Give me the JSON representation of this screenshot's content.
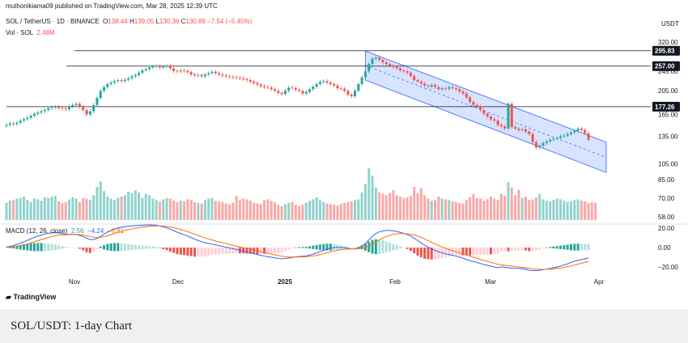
{
  "header": {
    "published": "muthonikiama09 published on TradingView.com, Mar 28, 2025 12:39 UTC",
    "symbol": "SOL / TetherUS · 1D · BINANCE",
    "o_label": "O",
    "o": "138.44",
    "h_label": "H",
    "h": "139.05",
    "l_label": "L",
    "l": "130.36",
    "c_label": "C",
    "c": "130.89",
    "change": "−7.54 (−5.45%)",
    "vol_label": "Vol · SOL",
    "vol": "2.48M",
    "currency": "USDT"
  },
  "macd": {
    "label": "MACD (12, 26, close)",
    "hist": "2.56",
    "macd": "−4.24",
    "signal": "−6.81"
  },
  "footer": {
    "logo": "TradingView",
    "caption": "SOL/USDT: 1-day Chart"
  },
  "colors": {
    "up": "#26a69a",
    "down": "#ef5350",
    "channel": "#2962ff",
    "macd_line": "#2962ff",
    "signal_line": "#ff6d00"
  },
  "chart_data": [
    {
      "type": "candlestick",
      "axis": "log",
      "ylim": [
        95,
        330
      ],
      "y_ticks": [
        "320.00",
        "245.00",
        "205.00",
        "165.00",
        "135.00",
        "105.00"
      ],
      "x_ticks": [
        "Nov",
        "Dec",
        "2025",
        "Feb",
        "Mar",
        "Apr"
      ],
      "price_labels": [
        {
          "value": 295.83,
          "text": "295.83"
        },
        {
          "value": 257.0,
          "text": "257.00"
        },
        {
          "value": 177.26,
          "text": "177.26"
        }
      ],
      "horizontal_lines": [
        295.83,
        257.0,
        177.26
      ],
      "close": [
        150,
        152,
        151,
        153,
        156,
        158,
        160,
        163,
        166,
        168,
        170,
        172,
        175,
        176,
        177,
        175,
        174,
        173,
        178,
        180,
        182,
        177,
        172,
        165,
        170,
        180,
        192,
        205,
        212,
        218,
        221,
        224,
        226,
        224,
        227,
        230,
        234,
        237,
        242,
        247,
        250,
        254,
        256,
        258,
        254,
        256,
        258,
        252,
        246,
        245,
        247,
        246,
        243,
        238,
        236,
        237,
        234,
        238,
        241,
        244,
        241,
        238,
        236,
        234,
        233,
        232,
        231,
        230,
        228,
        226,
        223,
        220,
        217,
        214,
        212,
        211,
        208,
        205,
        201,
        199,
        205,
        211,
        210,
        207,
        205,
        200,
        203,
        208,
        213,
        218,
        222,
        224,
        221,
        218,
        215,
        210,
        209,
        205,
        198,
        195,
        205,
        218,
        232,
        245,
        262,
        275,
        278,
        272,
        266,
        262,
        258,
        255,
        252,
        247,
        245,
        242,
        235,
        226,
        223,
        219,
        215,
        213,
        216,
        212,
        208,
        210,
        209,
        212,
        210,
        208,
        204,
        200,
        193,
        185,
        180,
        178,
        172,
        166,
        162,
        158,
        156,
        150,
        148,
        145,
        182,
        147,
        145,
        143,
        144,
        141,
        138,
        128,
        122,
        124,
        127,
        129,
        131,
        132,
        133,
        135,
        136,
        138,
        140,
        142,
        145,
        143,
        139,
        131
      ]
    },
    {
      "type": "bar",
      "name": "Vol · SOL",
      "values": [
        2.5,
        2.8,
        2.9,
        3.1,
        3.2,
        3.4,
        2.9,
        2.6,
        3.1,
        3.0,
        2.8,
        3.3,
        3.2,
        3.4,
        3.5,
        2.7,
        2.5,
        2.6,
        3.0,
        3.3,
        3.1,
        2.6,
        3.2,
        3.1,
        2.9,
        3.6,
        4.8,
        5.6,
        4.2,
        3.4,
        3.1,
        2.9,
        3.2,
        3.4,
        3.6,
        4.1,
        3.9,
        4.3,
        4.0,
        3.2,
        3.8,
        3.6,
        3.1,
        2.9,
        2.7,
        3.0,
        3.2,
        3.1,
        2.8,
        2.6,
        2.8,
        2.7,
        3.0,
        2.9,
        2.6,
        2.5,
        2.4,
        2.9,
        3.1,
        3.2,
        2.8,
        2.7,
        2.6,
        2.4,
        2.3,
        2.5,
        3.5,
        2.9,
        3.1,
        3.0,
        2.8,
        2.5,
        2.4,
        2.3,
        2.9,
        3.0,
        2.8,
        2.6,
        2.2,
        2.0,
        2.3,
        2.5,
        2.6,
        2.2,
        2.0,
        2.2,
        2.5,
        2.8,
        3.0,
        3.3,
        2.9,
        2.6,
        2.4,
        2.3,
        2.2,
        2.1,
        2.3,
        2.5,
        2.6,
        2.7,
        2.9,
        3.0,
        4.0,
        5.2,
        7.5,
        6.4,
        4.7,
        4.0,
        3.8,
        3.6,
        3.9,
        4.3,
        3.6,
        3.4,
        3.2,
        3.3,
        3.5,
        4.8,
        3.9,
        4.6,
        3.6,
        3.1,
        2.8,
        2.9,
        3.4,
        3.1,
        3.0,
        2.9,
        2.7,
        2.6,
        2.5,
        2.4,
        2.9,
        3.3,
        3.8,
        3.2,
        3.1,
        2.8,
        3.0,
        3.4,
        3.1,
        2.9,
        3.8,
        3.5,
        5.5,
        4.7,
        3.6,
        4.4,
        3.2,
        3.4,
        2.9,
        3.0,
        3.3,
        3.8,
        3.0,
        2.8,
        2.7,
        2.9,
        3.1,
        3.0,
        2.8,
        2.6,
        2.7,
        2.9,
        3.0,
        2.8,
        2.7,
        2.5,
        2.6,
        2.5
      ]
    },
    {
      "type": "line",
      "name": "MACD (12, 26, close)",
      "y_ticks": [
        "20.00",
        "0.00",
        "−20.00"
      ],
      "macd": [
        0.5,
        1.2,
        2.0,
        3.2,
        4.5,
        6.0,
        7.4,
        9.0,
        10.5,
        11.8,
        12.9,
        13.8,
        14.6,
        15.1,
        15.3,
        15.0,
        14.4,
        13.8,
        13.6,
        13.6,
        13.4,
        12.5,
        11.2,
        9.4,
        8.2,
        8.2,
        9.4,
        11.6,
        13.8,
        15.9,
        17.6,
        19.0,
        20.2,
        21.0,
        21.6,
        22.0,
        22.3,
        22.6,
        22.8,
        23.0,
        23.2,
        23.3,
        23.2,
        23.0,
        22.2,
        21.2,
        20.3,
        19.0,
        17.4,
        15.8,
        14.5,
        13.2,
        11.8,
        10.2,
        8.6,
        7.3,
        6.0,
        5.0,
        4.2,
        3.6,
        2.8,
        2.0,
        1.2,
        0.4,
        -0.4,
        -1.2,
        -2.0,
        -2.8,
        -3.6,
        -4.5,
        -5.4,
        -6.3,
        -7.2,
        -8.0,
        -8.8,
        -9.4,
        -10.0,
        -10.6,
        -11.2,
        -11.6,
        -11.4,
        -10.8,
        -10.2,
        -9.6,
        -9.2,
        -9.0,
        -8.6,
        -7.8,
        -6.8,
        -5.6,
        -4.2,
        -2.8,
        -1.6,
        -0.6,
        0.0,
        0.2,
        0.2,
        -0.2,
        -0.8,
        -1.4,
        -1.6,
        -0.6,
        1.4,
        4.2,
        7.8,
        11.6,
        14.4,
        16.2,
        17.2,
        17.6,
        17.6,
        17.2,
        16.6,
        15.6,
        14.6,
        13.4,
        11.8,
        9.6,
        7.2,
        4.8,
        2.4,
        0.4,
        -1.4,
        -3.0,
        -4.4,
        -5.4,
        -6.4,
        -7.2,
        -8.0,
        -8.8,
        -9.8,
        -11.0,
        -12.2,
        -13.4,
        -14.4,
        -15.4,
        -16.4,
        -17.4,
        -18.2,
        -19.2,
        -20.0,
        -20.8,
        -19.8,
        -20.2,
        -20.8,
        -21.2,
        -21.4,
        -21.6,
        -21.8,
        -22.4,
        -23.4,
        -23.8,
        -23.8,
        -23.4,
        -22.8,
        -22.2,
        -21.6,
        -20.8,
        -20.0,
        -19.0,
        -18.0,
        -16.8,
        -15.4,
        -14.2,
        -13.2,
        -12.4,
        -11.6,
        -10.8,
        -10.0,
        -9.2,
        -8.4,
        -6.8,
        -5.4,
        -4.24
      ],
      "signal": [
        0.2,
        0.4,
        0.8,
        1.3,
        2.0,
        2.8,
        3.7,
        4.8,
        5.9,
        7.1,
        8.2,
        9.3,
        10.4,
        11.3,
        12.1,
        12.7,
        13.0,
        13.2,
        13.3,
        13.4,
        13.4,
        13.2,
        12.8,
        12.1,
        11.3,
        10.7,
        10.4,
        10.7,
        11.3,
        12.2,
        13.3,
        14.4,
        15.6,
        16.6,
        17.6,
        18.5,
        19.2,
        19.9,
        20.5,
        21.0,
        21.4,
        21.8,
        22.1,
        22.3,
        22.3,
        22.1,
        21.8,
        21.3,
        20.5,
        19.6,
        18.6,
        17.5,
        16.4,
        15.1,
        13.8,
        12.5,
        11.2,
        9.9,
        8.8,
        7.8,
        6.8,
        5.8,
        4.9,
        4.0,
        3.1,
        2.2,
        1.4,
        0.6,
        -0.2,
        -1.0,
        -1.8,
        -2.6,
        -3.5,
        -4.4,
        -5.2,
        -6.0,
        -6.8,
        -7.5,
        -8.2,
        -8.9,
        -9.4,
        -9.7,
        -9.8,
        -9.8,
        -9.7,
        -9.6,
        -9.4,
        -9.1,
        -8.7,
        -8.1,
        -7.3,
        -6.4,
        -5.4,
        -4.5,
        -3.6,
        -2.8,
        -2.2,
        -1.8,
        -1.6,
        -1.5,
        -1.5,
        -1.3,
        -0.8,
        0.2,
        1.8,
        3.7,
        5.8,
        7.9,
        9.7,
        11.3,
        12.6,
        13.5,
        14.1,
        14.4,
        14.4,
        14.2,
        13.7,
        12.9,
        11.8,
        10.4,
        8.8,
        7.1,
        5.4,
        3.7,
        2.1,
        0.6,
        -0.8,
        -2.1,
        -3.3,
        -4.4,
        -5.5,
        -6.6,
        -7.7,
        -8.9,
        -10.0,
        -11.1,
        -12.2,
        -13.3,
        -14.3,
        -15.3,
        -16.3,
        -17.2,
        -17.7,
        -18.2,
        -18.7,
        -19.2,
        -19.6,
        -20.0,
        -20.4,
        -20.8,
        -21.3,
        -21.8,
        -22.2,
        -22.4,
        -22.5,
        -22.4,
        -22.2,
        -21.9,
        -21.5,
        -21.0,
        -20.4,
        -19.7,
        -18.9,
        -18.0,
        -17.1,
        -16.2,
        -15.3,
        -14.4,
        -13.6,
        -12.8,
        -12.0,
        -11.0,
        -9.9,
        -6.81
      ]
    }
  ]
}
